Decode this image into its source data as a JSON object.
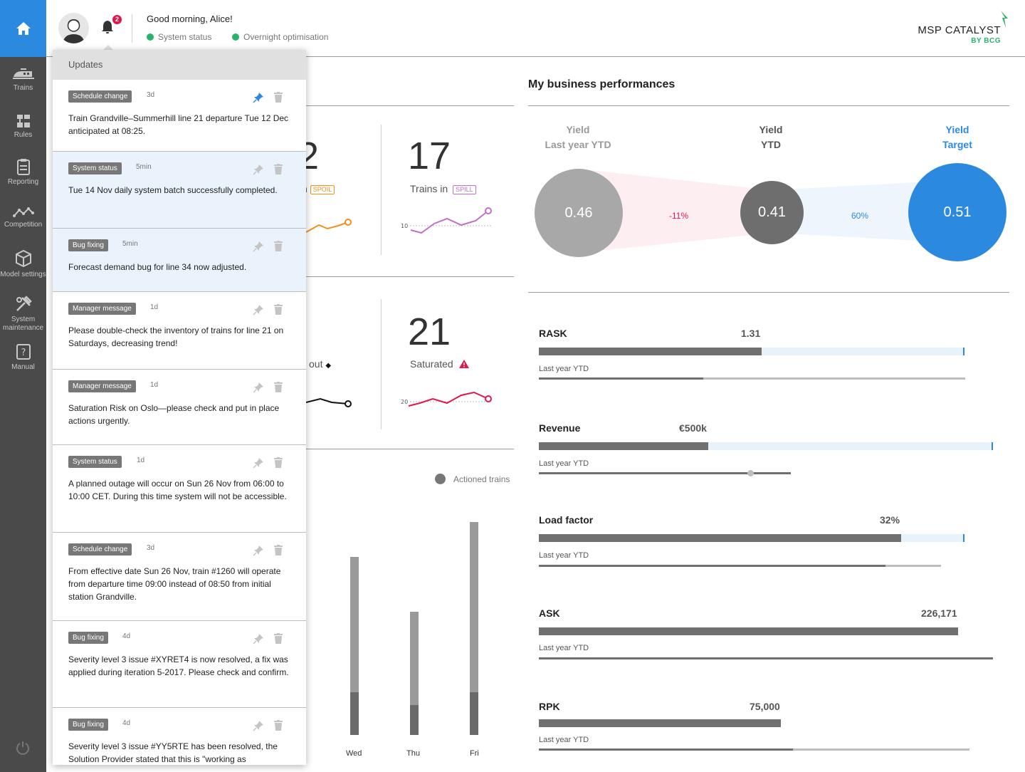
{
  "sidebar": {
    "items": [
      {
        "label": "Trains",
        "icon": "train-icon"
      },
      {
        "label": "Rules",
        "icon": "rules-icon"
      },
      {
        "label": "Reporting",
        "icon": "clipboard-icon"
      },
      {
        "label": "Competition",
        "icon": "trend-line-icon"
      },
      {
        "label": "Model settings",
        "icon": "cube-icon"
      },
      {
        "label": "System maintenance",
        "icon": "tools-icon"
      },
      {
        "label": "Manual",
        "icon": "manual-icon"
      }
    ]
  },
  "header": {
    "greeting": "Good morning, Alice!",
    "notification_count": "2",
    "status_1": "System status",
    "status_2": "Overnight optimisation",
    "brand_name": "MSP CATALYST",
    "brand_sub": "BY BCG"
  },
  "updates": {
    "title": "Updates",
    "items": [
      {
        "tag": "Schedule change",
        "time": "3d",
        "message": "Train Grandville–Summerhill line 21 departure Tue 12 Dec anticipated at 08:25.",
        "pinned": true,
        "selected": false
      },
      {
        "tag": "System status",
        "time": "5min",
        "message": "Tue 14 Nov daily system batch successfully completed.",
        "pinned": false,
        "selected": true
      },
      {
        "tag": "Bug fixing",
        "time": "5min",
        "message": "Forecast demand bug for line 34 now adjusted.",
        "pinned": false,
        "selected": true
      },
      {
        "tag": "Manager message",
        "time": "1d",
        "message": "Please double-check the inventory of trains for line 21 on Saturdays, decreasing trend!",
        "pinned": false,
        "selected": false
      },
      {
        "tag": "Manager message",
        "time": "1d",
        "message": "Saturation Risk on Oslo—please check and put in place actions urgently.",
        "pinned": false,
        "selected": false
      },
      {
        "tag": "System status",
        "time": "1d",
        "message": "A planned outage will occur on Sun 26 Nov from 06:00 to 10:00 CET. During this time system will not be accessible.",
        "pinned": false,
        "selected": false
      },
      {
        "tag": "Schedule change",
        "time": "3d",
        "message": "From effective date Sun 26 Nov, train #1260 will operate from departure time 09:00 instead of 08:50 from initial station Grandville.",
        "pinned": false,
        "selected": false
      },
      {
        "tag": "Bug fixing",
        "time": "4d",
        "message": "Severity level 3 issue #XYRET4 is now resolved, a fix was applied  during iteration 5-2017. Please check and confirm.",
        "pinned": false,
        "selected": false
      },
      {
        "tag": "Bug fixing",
        "time": "4d",
        "message": "Severity level 3 issue #YY5RTE has been resolved, the Solution Provider stated that this is \"working as",
        "pinned": false,
        "selected": false
      }
    ]
  },
  "main": {
    "kpi_partial_digit": "2",
    "kpi_partial_suffix": "n",
    "kpi_partial_tag": "SPOIL",
    "kpi_trains_in_value": "17",
    "kpi_trains_in_label": "Trains in",
    "kpi_trains_in_tag": "SPILL",
    "kpi_trains_in_ref": "10",
    "kpi_out_label": "out",
    "kpi_saturated_value": "21",
    "kpi_saturated_label": "Saturated",
    "kpi_saturated_ref": "20",
    "legend_actioned": "Actioned trains",
    "days": [
      "Wed",
      "Thu",
      "Fri"
    ],
    "colors": {
      "spoil": "#f0901e",
      "spill": "#c070c8",
      "saturated": "#e0174b"
    }
  },
  "performance": {
    "title": "My business performances",
    "yield": {
      "last_year_label_1": "Yield",
      "last_year_label_2": "Last year YTD",
      "last_year_value": "0.46",
      "ytd_label_1": "Yield",
      "ytd_label_2": "YTD",
      "ytd_value": "0.41",
      "target_label_1": "Yield",
      "target_label_2": "Target",
      "target_value": "0.51",
      "delta_ly": "-11%",
      "delta_target": "60%"
    },
    "metrics": [
      {
        "name": "RASK",
        "value": "1.31",
        "last_year_label": "Last year YTD"
      },
      {
        "name": "Revenue",
        "value": "€500k",
        "last_year_label": "Last year YTD"
      },
      {
        "name": "Load factor",
        "value": "32%",
        "last_year_label": "Last year YTD"
      },
      {
        "name": "ASK",
        "value": "226,171",
        "last_year_label": "Last year YTD"
      },
      {
        "name": "RPK",
        "value": "75,000",
        "last_year_label": "Last year YTD"
      }
    ]
  },
  "colors": {
    "accent": "#2b8ae0",
    "sidebar": "#4a4a4a",
    "status_green": "#26b36a",
    "alert": "#e0174b"
  }
}
